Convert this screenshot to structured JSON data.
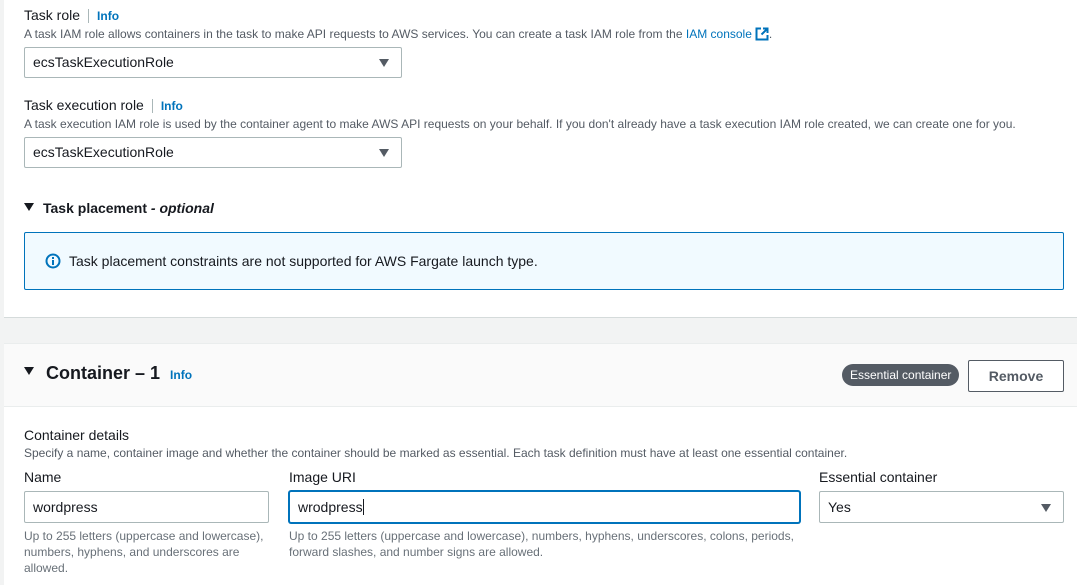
{
  "task_role": {
    "label": "Task role",
    "info": "Info",
    "description_prefix": "A task IAM role allows containers in the task to make API requests to AWS services. You can create a task IAM role from the ",
    "description_link": "IAM console",
    "description_suffix": ".",
    "value": "ecsTaskExecutionRole"
  },
  "task_execution_role": {
    "label": "Task execution role",
    "info": "Info",
    "description": "A task execution IAM role is used by the container agent to make AWS API requests on your behalf. If you don't already have a task execution IAM role created, we can create one for you.",
    "value": "ecsTaskExecutionRole"
  },
  "task_placement": {
    "title": "Task placement",
    "optional": "- optional",
    "alert": "Task placement constraints are not supported for AWS Fargate launch type."
  },
  "container": {
    "title": "Container – 1",
    "info": "Info",
    "badge": "Essential container",
    "remove_label": "Remove",
    "details_title": "Container details",
    "details_description": "Specify a name, container image and whether the container should be marked as essential. Each task definition must have at least one essential container.",
    "name_label": "Name",
    "name_value": "wordpress",
    "name_help": "Up to 255 letters (uppercase and lowercase), numbers, hyphens, and underscores are allowed.",
    "image_label": "Image URI",
    "image_value": "wrodpress",
    "image_help": "Up to 255 letters (uppercase and lowercase), numbers, hyphens, underscores, colons, periods, forward slashes, and number signs are allowed.",
    "essential_label": "Essential container",
    "essential_value": "Yes"
  },
  "colors": {
    "link": "#0073bb",
    "badge": "#545b64",
    "alert_bg": "#f1faff"
  },
  "icons": [
    "external-link-icon",
    "caret-down-icon",
    "info-circle-icon",
    "expand-triangle-icon"
  ]
}
